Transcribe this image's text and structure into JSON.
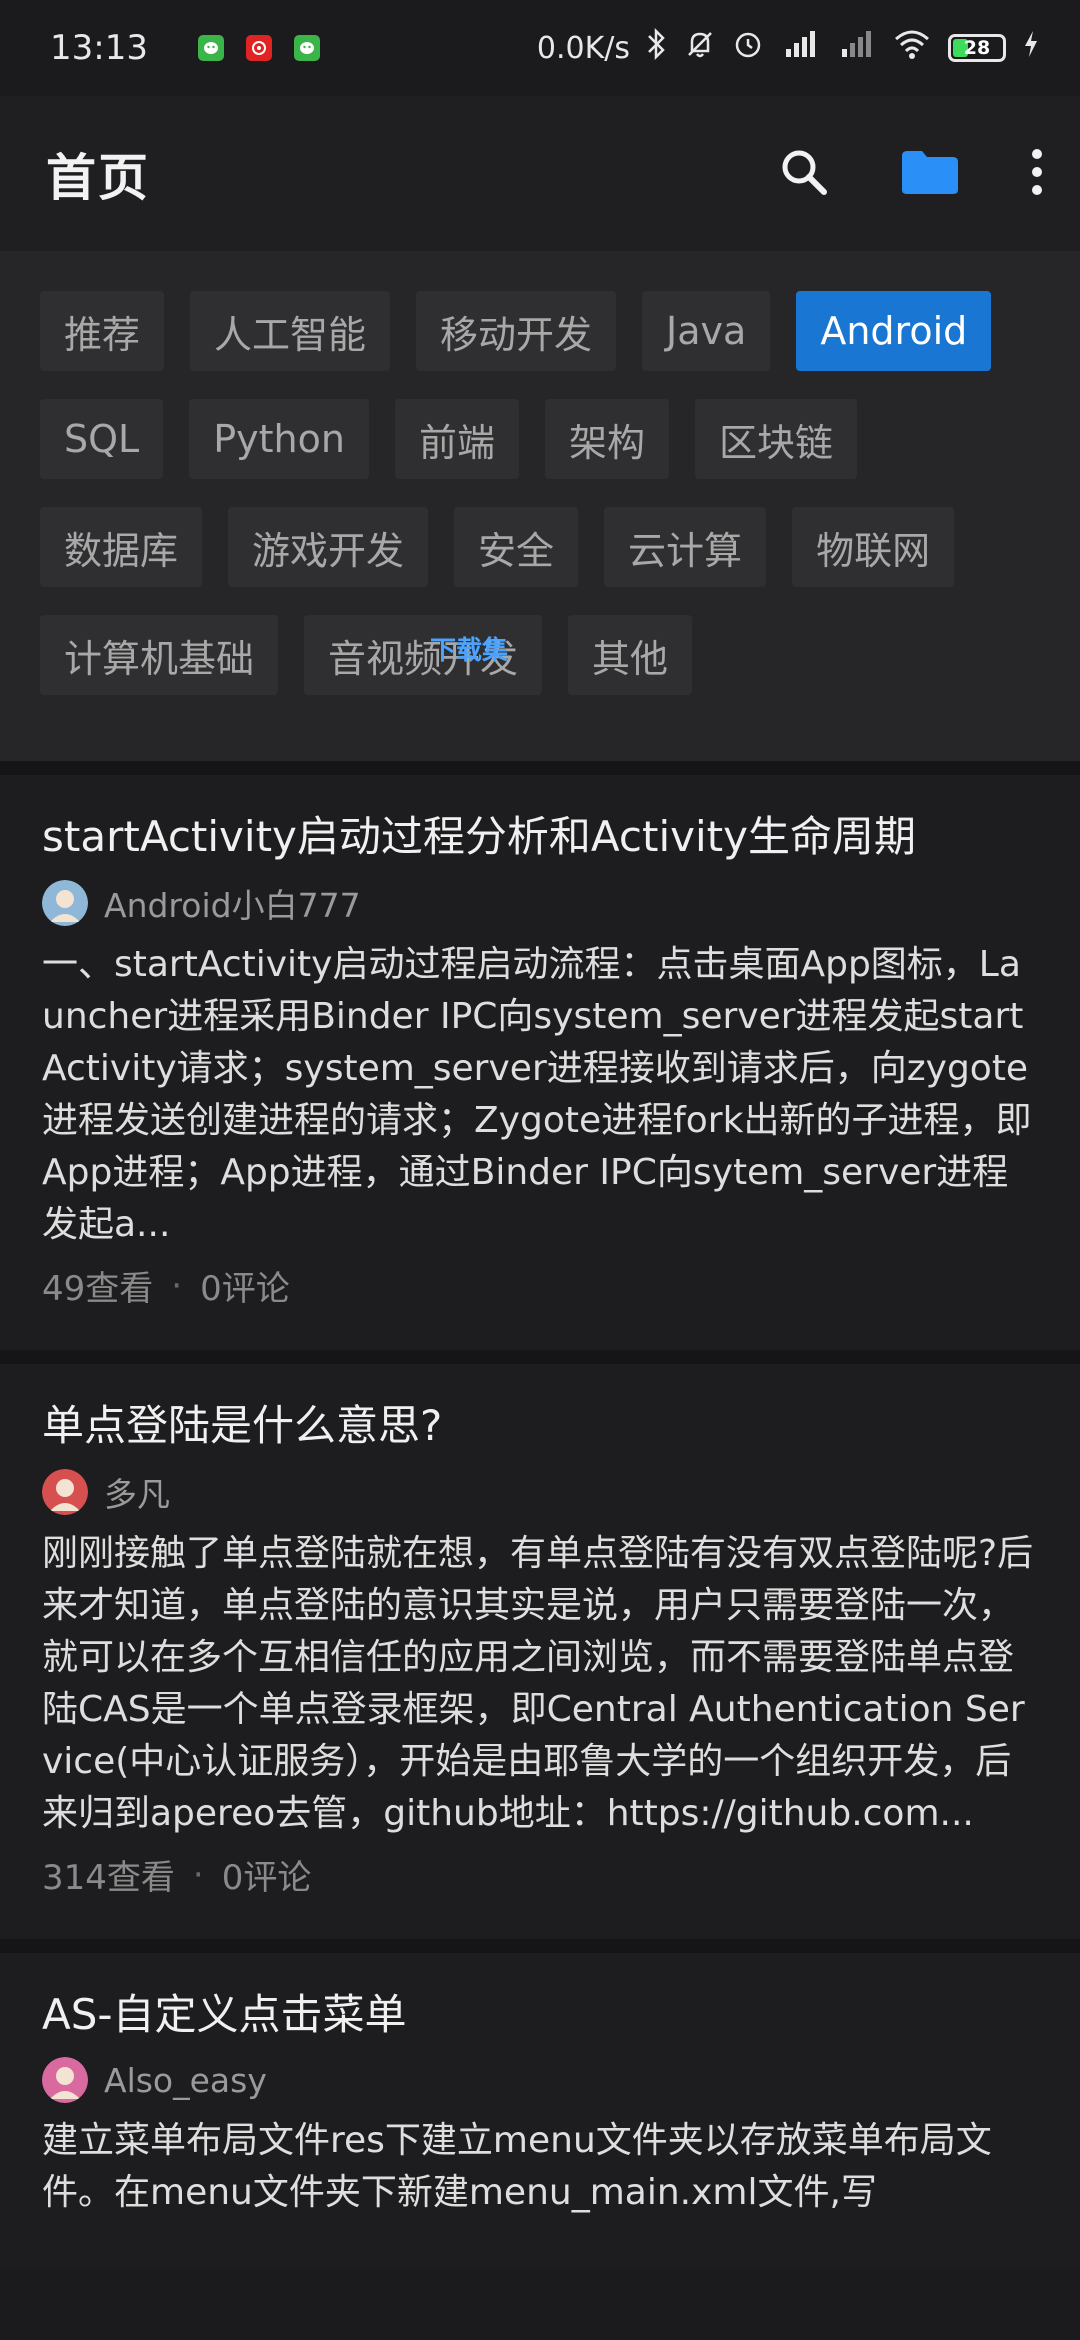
{
  "status_bar": {
    "time": "13:13",
    "net_speed": "0.0K/s",
    "battery": "28"
  },
  "app_bar": {
    "title": "首页",
    "search_icon": "search-icon",
    "folder_icon": "folder-icon",
    "more_icon": "more-vert-icon",
    "accent": "#1e88e5"
  },
  "tags": [
    {
      "label": "推荐",
      "active": false
    },
    {
      "label": "人工智能",
      "active": false
    },
    {
      "label": "移动开发",
      "active": false
    },
    {
      "label": "Java",
      "active": false
    },
    {
      "label": "Android",
      "active": true
    },
    {
      "label": "SQL",
      "active": false
    },
    {
      "label": "Python",
      "active": false
    },
    {
      "label": "前端",
      "active": false
    },
    {
      "label": "架构",
      "active": false
    },
    {
      "label": "区块链",
      "active": false
    },
    {
      "label": "数据库",
      "active": false
    },
    {
      "label": "游戏开发",
      "active": false
    },
    {
      "label": "安全",
      "active": false
    },
    {
      "label": "云计算",
      "active": false
    },
    {
      "label": "物联网",
      "active": false
    },
    {
      "label": "计算机基础",
      "active": false
    },
    {
      "label": "音视频开发",
      "active": false
    },
    {
      "label": "其他",
      "active": false
    }
  ],
  "watermark": "下载集",
  "articles": [
    {
      "title": "startActivity启动过程分析和Activity生命周期",
      "author": "Android小白777",
      "summary": "一、startActivity启动过程启动流程：点击桌面App图标，Launcher进程采用Binder IPC向system_server进程发起startActivity请求；system_server进程接收到请求后，向zygote进程发送创建进程的请求；Zygote进程fork出新的子进程，即App进程；App进程，通过Binder IPC向sytem_server进程发起a...",
      "views": "49查看",
      "comments": "0评论"
    },
    {
      "title": "单点登陆是什么意思?",
      "author": "多凡",
      "summary": "刚刚接触了单点登陆就在想，有单点登陆有没有双点登陆呢?后来才知道，单点登陆的意识其实是说，用户只需要登陆一次，就可以在多个互相信任的应用之间浏览，而不需要登陆单点登陆CAS是一个单点登录框架，即Central Authentication Service(中心认证服务），开始是由耶鲁大学的一个组织开发，后来归到apereo去管，github地址：https://github.com...",
      "views": "314查看",
      "comments": "0评论"
    },
    {
      "title": "AS-自定义点击菜单",
      "author": "Also_easy",
      "summary": "建立菜单布局文件res下建立menu文件夹以存放菜单布局文件。在menu文件夹下新建menu_main.xml文件,写",
      "views": "",
      "comments": ""
    }
  ]
}
